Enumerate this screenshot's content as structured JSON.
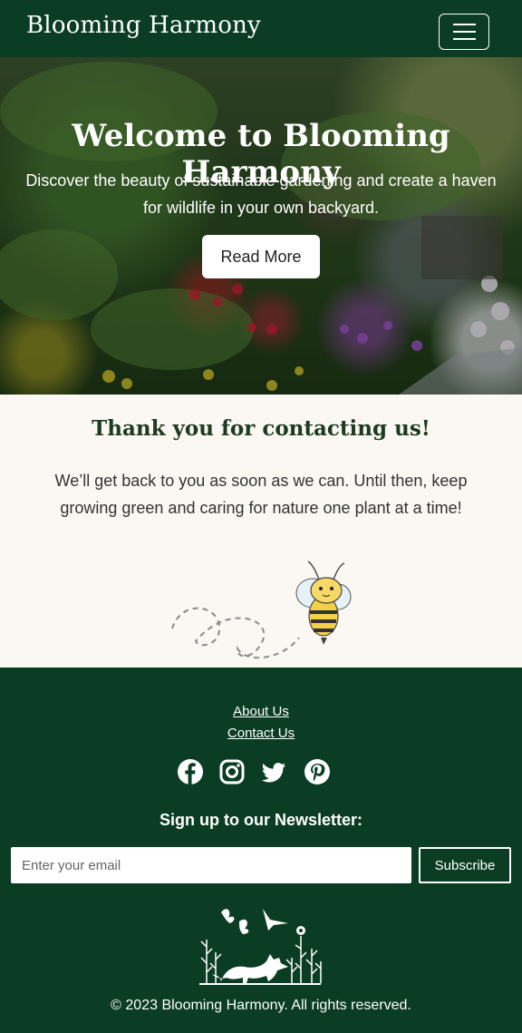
{
  "navbar": {
    "brand": "Blooming Harmony",
    "toggle_icon": "hamburger-menu-icon"
  },
  "hero": {
    "title": "Welcome to Blooming Harmony",
    "text": "Discover the beauty of sustainable gardening and create a haven for wildlife in your own backyard.",
    "button_label": "Read More"
  },
  "thanks": {
    "title": "Thank you for contacting us!",
    "text": "We’ll get back to you as soon as we can. Until then, keep growing green and caring for nature one plant at a time!",
    "illustration": "bee-illustration"
  },
  "footer": {
    "links": [
      "About Us",
      "Contact Us"
    ],
    "social_icons": [
      "facebook-icon",
      "instagram-icon",
      "twitter-icon",
      "pinterest-icon"
    ],
    "newsletter_title": "Sign up to our Newsletter:",
    "email_placeholder": "Enter your email",
    "subscribe_label": "Subscribe",
    "logo": "fox-wildlife-logo",
    "copyright": "© 2023 Blooming Harmony. All rights reserved."
  },
  "colors": {
    "primary_green": "#0b3d24",
    "background": "#fbf8f4",
    "white": "#ffffff"
  }
}
